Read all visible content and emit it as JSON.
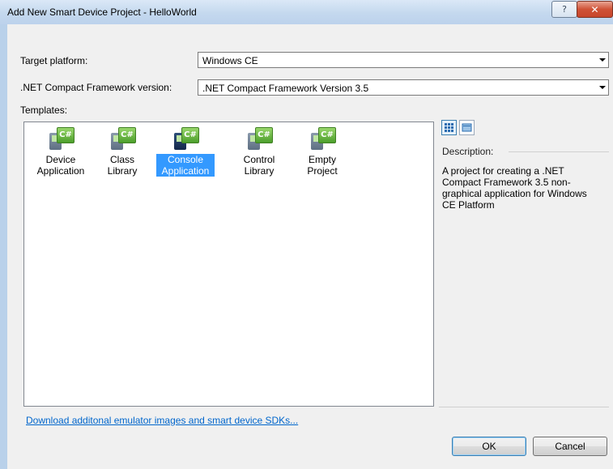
{
  "window": {
    "title": "Add New Smart Device Project - HelloWorld",
    "help_glyph": "?",
    "close_glyph": "✕"
  },
  "form": {
    "target_platform_label": "Target platform:",
    "target_platform_value": "Windows CE",
    "framework_label": ".NET Compact Framework version:",
    "framework_value": ".NET Compact Framework Version 3.5"
  },
  "templates": {
    "label": "Templates:",
    "items": [
      {
        "name": "Device\nApplication",
        "icon": "device-application-icon",
        "selected": false
      },
      {
        "name": "Class Library",
        "icon": "class-library-icon",
        "selected": false
      },
      {
        "name": "Console\nApplication",
        "icon": "console-application-icon",
        "selected": true
      },
      {
        "name": "Control\nLibrary",
        "icon": "control-library-icon",
        "selected": false
      },
      {
        "name": "Empty\nProject",
        "icon": "empty-project-icon",
        "selected": false
      }
    ],
    "icon_badge": "C#",
    "view_modes": [
      "large-icons",
      "small-icons"
    ]
  },
  "description": {
    "label": "Description:",
    "text": "A project for creating a .NET Compact Framework 3.5 non-graphical application for Windows CE Platform"
  },
  "links": {
    "sdk": "Download additonal emulator images and smart device SDKs..."
  },
  "buttons": {
    "ok": "OK",
    "cancel": "Cancel"
  },
  "colors": {
    "selection": "#3399ff",
    "link": "#0066cc",
    "close_button": "#c7452b"
  }
}
